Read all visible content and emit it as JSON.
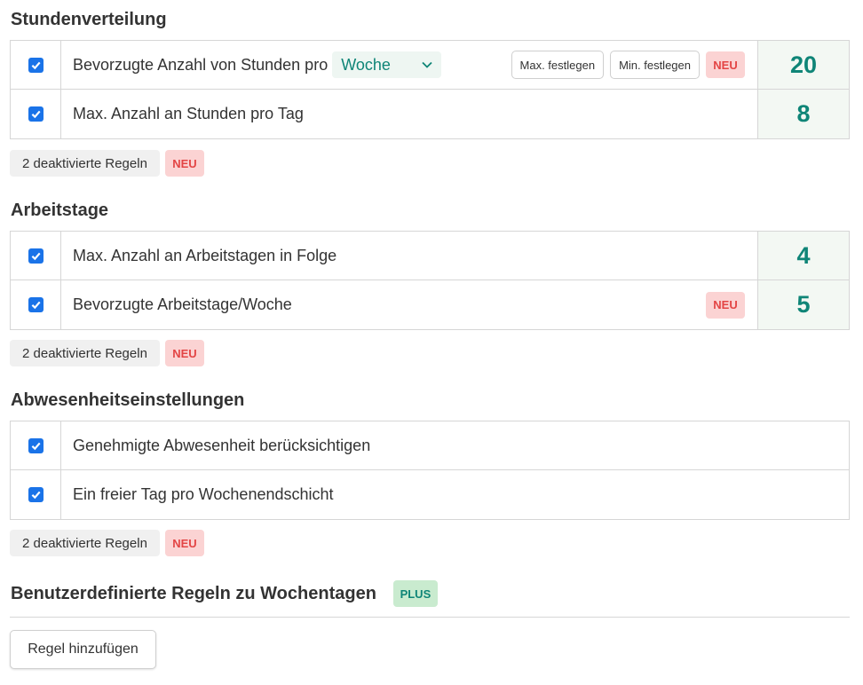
{
  "colors": {
    "accent": "#0f8577",
    "checkbox": "#1a73e8",
    "badge_neu_bg": "#fbd3d3",
    "badge_neu_text": "#e34545",
    "badge_plus_bg": "#c9ebcf"
  },
  "sections": {
    "stundenverteilung": {
      "title": "Stundenverteilung",
      "rows": [
        {
          "label": "Bevorzugte Anzahl von Stunden pro",
          "select_value": "Woche",
          "max_button": "Max. festlegen",
          "min_button": "Min. festlegen",
          "badge": "NEU",
          "value": "20",
          "checked": true
        },
        {
          "label": "Max. Anzahl an Stunden pro Tag",
          "value": "8",
          "checked": true
        }
      ],
      "disabled_rules": "2 deaktivierte Regeln",
      "disabled_badge": "NEU"
    },
    "arbeitstage": {
      "title": "Arbeitstage",
      "rows": [
        {
          "label": "Max. Anzahl an Arbeitstagen in Folge",
          "value": "4",
          "checked": true
        },
        {
          "label": "Bevorzugte Arbeitstage/Woche",
          "badge": "NEU",
          "value": "5",
          "checked": true
        }
      ],
      "disabled_rules": "2 deaktivierte Regeln",
      "disabled_badge": "NEU"
    },
    "abwesenheit": {
      "title": "Abwesenheitseinstellungen",
      "rows": [
        {
          "label": "Genehmigte Abwesenheit berücksichtigen",
          "checked": true
        },
        {
          "label": "Ein freier Tag pro Wochenendschicht",
          "checked": true
        }
      ],
      "disabled_rules": "2 deaktivierte Regeln",
      "disabled_badge": "NEU"
    },
    "benutzerdefiniert": {
      "title": "Benutzerdefinierte Regeln zu Wochentagen",
      "badge": "PLUS",
      "add_button": "Regel hinzufügen"
    }
  },
  "icons": {
    "checkbox": "check-icon",
    "select": "chevron-down-icon"
  }
}
